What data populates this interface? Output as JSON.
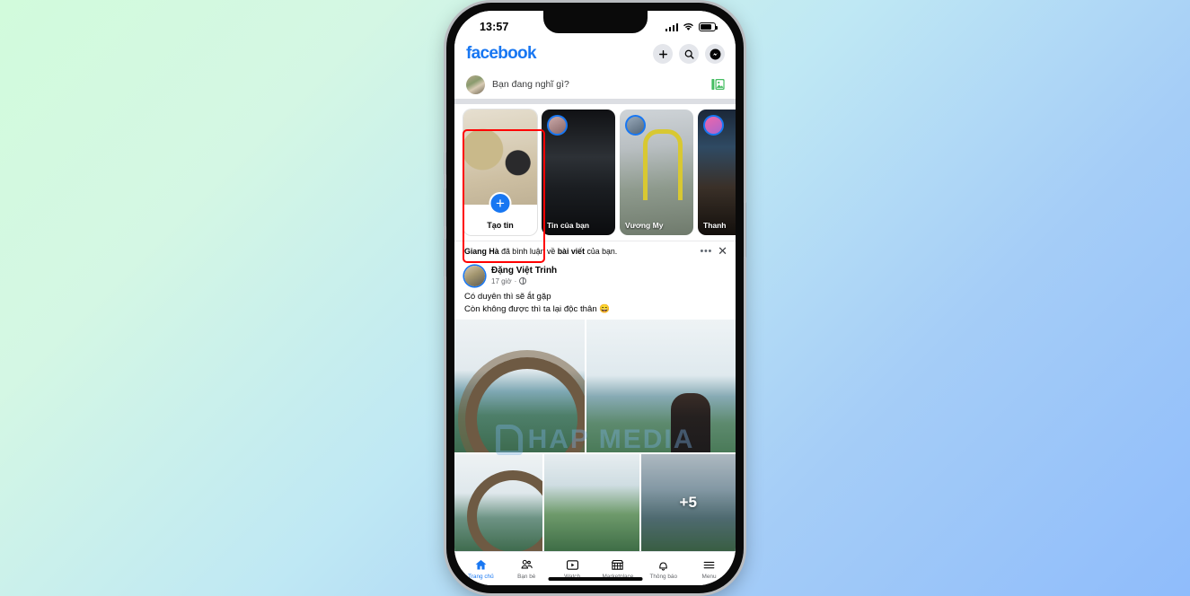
{
  "device": {
    "status_bar": {
      "time": "13:57",
      "signal_icon": "cellular-bars-icon",
      "wifi_icon": "wifi-icon",
      "battery_icon": "battery-icon"
    },
    "home_indicator": "home-indicator"
  },
  "app": {
    "name": "facebook",
    "header": {
      "logo_text": "facebook",
      "actions": [
        {
          "name": "add-button",
          "icon": "plus-icon"
        },
        {
          "name": "search-button",
          "icon": "search-icon"
        },
        {
          "name": "messenger-button",
          "icon": "messenger-icon"
        }
      ]
    },
    "composer": {
      "placeholder": "Bạn đang nghĩ gì?",
      "photo_icon": "photo-gallery-icon",
      "avatar": "user-avatar"
    },
    "stories": {
      "create": {
        "label": "Tạo tin",
        "plus_icon": "plus-icon",
        "highlighted": true,
        "highlight_color": "#ff0000"
      },
      "items": [
        {
          "name": "Tin của bạn"
        },
        {
          "name": "Vương My"
        },
        {
          "name": "Thanh"
        }
      ]
    },
    "feed": {
      "notification": {
        "actor": "Giang Hà",
        "text_before": " đã bình luận về ",
        "subject": "bài viết",
        "text_after": " của bạn.",
        "menu_icon": "more-options-icon",
        "close_icon": "close-icon"
      },
      "post": {
        "author": "Đặng Việt Trinh",
        "time": "17 giờ",
        "separator": "·",
        "privacy_icon": "globe-icon",
        "text_line_1": "Có duyên thì sẽ ắt gặp",
        "text_line_2": "Còn không được thì ta lại độc thân 😄",
        "photo_overflow_badge": "+5",
        "watermark": "HAP MEDIA"
      }
    },
    "bottom_nav": [
      {
        "label": "Trang chủ",
        "icon": "home-icon",
        "active": true
      },
      {
        "label": "Bạn bè",
        "icon": "friends-icon",
        "active": false
      },
      {
        "label": "Watch",
        "icon": "watch-video-icon",
        "active": false
      },
      {
        "label": "Marketplace",
        "icon": "store-icon",
        "active": false
      },
      {
        "label": "Thông báo",
        "icon": "bell-icon",
        "active": false
      },
      {
        "label": "Menu",
        "icon": "hamburger-menu-icon",
        "active": false
      }
    ]
  },
  "colors": {
    "brand_blue": "#1877F2",
    "highlight_red": "#ff0000",
    "text_primary": "#050505",
    "text_secondary": "#65676b"
  }
}
